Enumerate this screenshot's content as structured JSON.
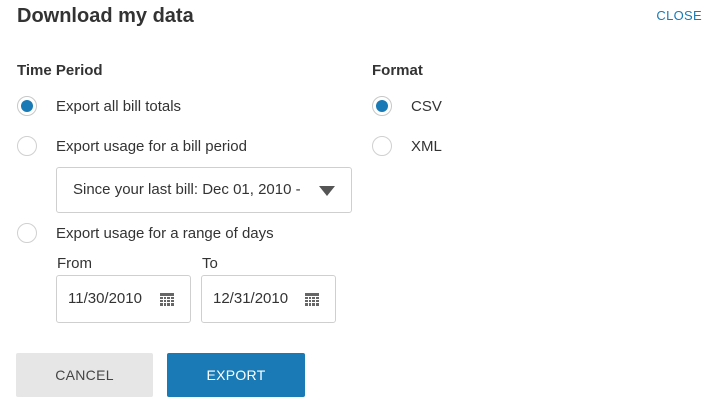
{
  "dialog": {
    "title": "Download my data",
    "close_label": "CLOSE"
  },
  "time_period": {
    "heading": "Time Period",
    "options": [
      {
        "label": "Export all bill totals",
        "checked": true
      },
      {
        "label": "Export usage for a bill period",
        "checked": false
      },
      {
        "label": "Export usage for a range of days",
        "checked": false
      }
    ],
    "bill_period_select": {
      "selected": "Since your last bill: Dec 01, 2010 - "
    },
    "range": {
      "from_label": "From",
      "from_value": "11/30/2010",
      "to_label": "To",
      "to_value": "12/31/2010"
    }
  },
  "format": {
    "heading": "Format",
    "options": [
      {
        "label": "CSV",
        "checked": true
      },
      {
        "label": "XML",
        "checked": false
      }
    ]
  },
  "actions": {
    "cancel_label": "CANCEL",
    "export_label": "EXPORT"
  },
  "colors": {
    "accent": "#1a7ab5",
    "cancel_bg": "#e6e6e6"
  }
}
